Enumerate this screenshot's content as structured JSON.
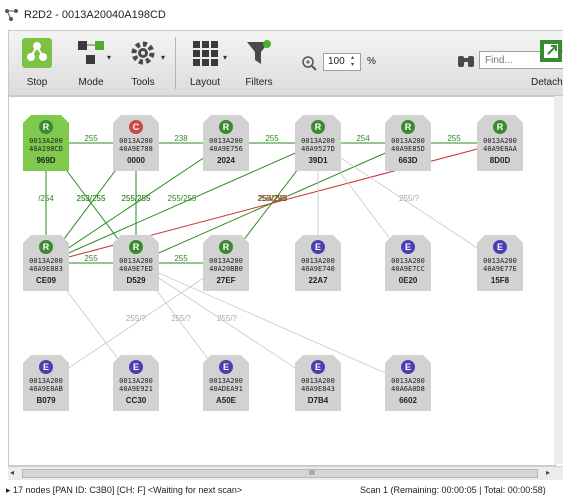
{
  "window": {
    "title": "R2D2 - 0013A20040A198CD"
  },
  "toolbar": {
    "stop_label": "Stop",
    "mode_label": "Mode",
    "tools_label": "Tools",
    "layout_label": "Layout",
    "filters_label": "Filters",
    "zoom_value": "100",
    "zoom_unit": "%",
    "find_placeholder": "Find...",
    "detach_label": "Detach"
  },
  "colors": {
    "coordinator": "#4caf2f",
    "router_badge": "#3c8a30",
    "coordinator_badge": "#c94a4a",
    "end_device_badge": "#4a3fb0",
    "node_fill": "#d2d2d2",
    "selected_fill": "#7fc94f",
    "link_green": "#2c8a22",
    "link_gray": "#c8c8c8",
    "link_red": "#c83232"
  },
  "nodes": [
    {
      "type": "R",
      "addr1": "0013A200",
      "addr2": "40A198CD",
      "short": "969D",
      "selected": true
    },
    {
      "type": "C",
      "addr1": "0013A200",
      "addr2": "40A9E788",
      "short": "0000"
    },
    {
      "type": "R",
      "addr1": "0013A200",
      "addr2": "40A9E756",
      "short": "2024"
    },
    {
      "type": "R",
      "addr1": "0013A200",
      "addr2": "40A9527D",
      "short": "39D1"
    },
    {
      "type": "R",
      "addr1": "0013A200",
      "addr2": "40A9E85D",
      "short": "663D"
    },
    {
      "type": "R",
      "addr1": "0013A200",
      "addr2": "40A9E8AA",
      "short": "8D0D"
    },
    {
      "type": "R",
      "addr1": "0013A200",
      "addr2": "40A9E883",
      "short": "CE09"
    },
    {
      "type": "R",
      "addr1": "0013A200",
      "addr2": "40A9E7ED",
      "short": "D529"
    },
    {
      "type": "R",
      "addr1": "0013A200",
      "addr2": "40A20BB0",
      "short": "27EF"
    },
    {
      "type": "E",
      "addr1": "0013A200",
      "addr2": "40A9E740",
      "short": "22A7"
    },
    {
      "type": "E",
      "addr1": "0013A200",
      "addr2": "40A9E7CC",
      "short": "0E20"
    },
    {
      "type": "E",
      "addr1": "0013A200",
      "addr2": "40A9E77E",
      "short": "15F8"
    },
    {
      "type": "E",
      "addr1": "0013A200",
      "addr2": "40A9E8AB",
      "short": "B079"
    },
    {
      "type": "E",
      "addr1": "0013A200",
      "addr2": "40A9E921",
      "short": "CC30"
    },
    {
      "type": "E",
      "addr1": "0013A200",
      "addr2": "40ADEA91",
      "short": "A50E"
    },
    {
      "type": "E",
      "addr1": "0013A200",
      "addr2": "40A9E843",
      "short": "D7B4"
    },
    {
      "type": "E",
      "addr1": "0013A200",
      "addr2": "40A6A0D8",
      "short": "6602"
    }
  ],
  "links": [
    {
      "from": 0,
      "to": 1,
      "label": "255",
      "color": "green"
    },
    {
      "from": 1,
      "to": 2,
      "label": "238",
      "color": "green"
    },
    {
      "from": 2,
      "to": 3,
      "label": "255",
      "color": "green"
    },
    {
      "from": 3,
      "to": 4,
      "label": "254",
      "color": "green"
    },
    {
      "from": 4,
      "to": 5,
      "label": "255",
      "color": "green"
    },
    {
      "from": 0,
      "to": 6,
      "label": "/254",
      "color": "green"
    },
    {
      "from": 1,
      "to": 6,
      "label": "253/255",
      "color": "green"
    },
    {
      "from": 1,
      "to": 7,
      "label": "255/255",
      "color": "green"
    },
    {
      "from": 0,
      "to": 7,
      "label": "253/255",
      "color": "green"
    },
    {
      "from": 2,
      "to": 6,
      "label": "255/255",
      "color": "green"
    },
    {
      "from": 3,
      "to": 6,
      "label": "255/255",
      "color": "green"
    },
    {
      "from": 4,
      "to": 7,
      "label": "255/255",
      "color": "green"
    },
    {
      "from": 3,
      "to": 8,
      "label": "255/255",
      "color": "green"
    },
    {
      "from": 6,
      "to": 7,
      "label": "255",
      "color": "green"
    },
    {
      "from": 7,
      "to": 8,
      "label": "255",
      "color": "green"
    },
    {
      "from": 5,
      "to": 6,
      "label": "254/246",
      "color": "red"
    },
    {
      "from": 3,
      "to": 11,
      "label": "255/?",
      "color": "gray"
    },
    {
      "from": 3,
      "to": 9,
      "label": "",
      "color": "gray"
    },
    {
      "from": 3,
      "to": 10,
      "label": "",
      "color": "gray"
    },
    {
      "from": 7,
      "to": 14,
      "label": "255/?",
      "color": "gray"
    },
    {
      "from": 7,
      "to": 15,
      "label": "255/?",
      "color": "gray"
    },
    {
      "from": 7,
      "to": 16,
      "label": "",
      "color": "gray"
    },
    {
      "from": 8,
      "to": 12,
      "label": "255/?",
      "color": "gray"
    },
    {
      "from": 6,
      "to": 13,
      "label": "",
      "color": "gray"
    }
  ],
  "scrollbar": {
    "grip": "III"
  },
  "status": {
    "left": "17 nodes [PAN ID: C3B0] [CH: F] <Waiting for next scan>",
    "right": "Scan 1 (Remaining: 00:00:05 | Total: 00:00:58)"
  }
}
